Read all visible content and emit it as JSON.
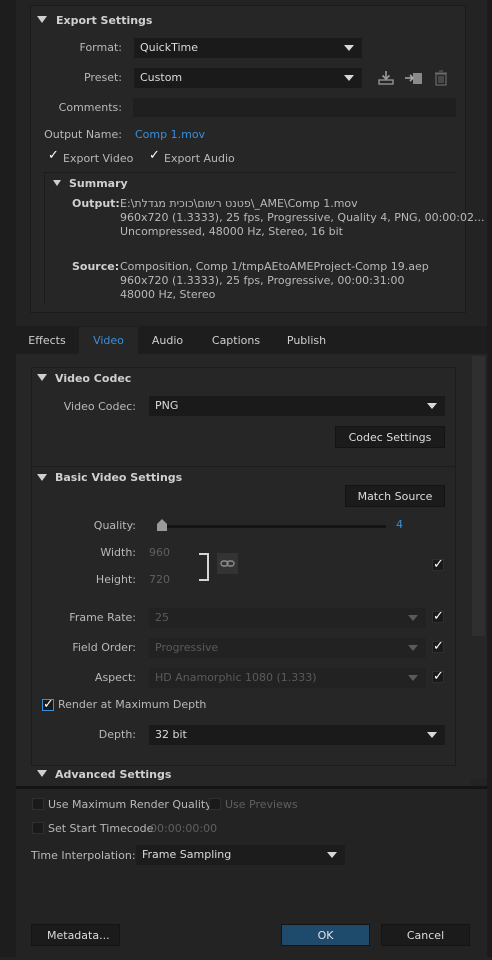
{
  "export": {
    "heading": "Export Settings",
    "format_label": "Format:",
    "format_value": "QuickTime",
    "preset_label": "Preset:",
    "preset_value": "Custom",
    "comments_label": "Comments:",
    "comments_value": "",
    "output_name_label": "Output Name:",
    "output_name_value": "Comp 1.mov",
    "export_video_label": "Export Video",
    "export_video_checked": true,
    "export_audio_label": "Export Audio",
    "export_audio_checked": true
  },
  "summary": {
    "heading": "Summary",
    "output_label": "Output:",
    "output_lines": [
      "E:\\פטנט רשום\\כוכית מגדלת\\_AME\\Comp 1.mov",
      "960x720 (1.3333), 25 fps, Progressive, Quality 4, PNG, 00:00:02...",
      "Uncompressed, 48000 Hz, Stereo, 16 bit"
    ],
    "source_label": "Source:",
    "source_lines": [
      "Composition, Comp 1/tmpAEtoAMEProject-Comp 19.aep",
      "960x720 (1.3333), 25 fps, Progressive, 00:00:31:00",
      "48000 Hz, Stereo"
    ]
  },
  "tabs": [
    "Effects",
    "Video",
    "Audio",
    "Captions",
    "Publish"
  ],
  "active_tab": "Video",
  "video_codec": {
    "heading": "Video Codec",
    "codec_label": "Video Codec:",
    "codec_value": "PNG",
    "codec_settings_label": "Codec Settings"
  },
  "basic": {
    "heading": "Basic Video Settings",
    "match_source_label": "Match Source",
    "quality_label": "Quality:",
    "quality_value": "4",
    "quality_level": 0,
    "width_label": "Width:",
    "width_value": "960",
    "height_label": "Height:",
    "height_value": "720",
    "dims_match_source": true,
    "frame_rate_label": "Frame Rate:",
    "frame_rate_value": "25",
    "frame_rate_match": true,
    "field_order_label": "Field Order:",
    "field_order_value": "Progressive",
    "field_order_match": true,
    "aspect_label": "Aspect:",
    "aspect_value": "HD Anamorphic 1080 (1.333)",
    "aspect_match": true,
    "render_max_depth_label": "Render at Maximum Depth",
    "render_max_depth_checked": true,
    "depth_label": "Depth:",
    "depth_value": "32 bit"
  },
  "advanced": {
    "heading": "Advanced Settings"
  },
  "bottom": {
    "use_max_render_quality_label": "Use Maximum Render Quality",
    "use_max_render_quality_checked": false,
    "use_previews_label": "Use Previews",
    "use_previews_checked": false,
    "set_start_timecode_label": "Set Start Timecode",
    "set_start_timecode_checked": false,
    "start_timecode_value": "00:00:00:00",
    "time_interpolation_label": "Time Interpolation:",
    "time_interpolation_value": "Frame Sampling",
    "metadata_label": "Metadata...",
    "ok_label": "OK",
    "cancel_label": "Cancel"
  },
  "colors": {
    "accent": "#3a8fd8",
    "ok_button": "#1e4a6b",
    "background": "#232323",
    "panel": "#262626"
  },
  "icons": [
    "save-preset-icon",
    "import-preset-icon",
    "delete-preset-icon",
    "link-chain-icon",
    "collapse-triangle-icon",
    "dropdown-arrow-icon"
  ]
}
